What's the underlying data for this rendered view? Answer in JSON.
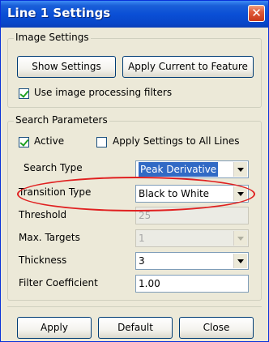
{
  "window": {
    "title": "Line 1 Settings",
    "close_glyph": "✕"
  },
  "image_settings": {
    "legend": "Image Settings",
    "show_settings_label": "Show Settings",
    "apply_current_label": "Apply Current to Feature",
    "use_filters_label": "Use image processing filters",
    "use_filters_checked": true
  },
  "search_params": {
    "legend": "Search Parameters",
    "active_label": "Active",
    "active_checked": true,
    "apply_all_label": "Apply Settings to All Lines",
    "apply_all_checked": false,
    "fields": {
      "search_type": {
        "label": "Search Type",
        "value": "Peak Derivative"
      },
      "transition_type": {
        "label": "Transition Type",
        "value": "Black to White"
      },
      "threshold": {
        "label": "Threshold",
        "value": "25"
      },
      "max_targets": {
        "label": "Max. Targets",
        "value": "1"
      },
      "thickness": {
        "label": "Thickness",
        "value": "3"
      },
      "filter_coefficient": {
        "label": "Filter Coefficient",
        "value": "1.00"
      }
    }
  },
  "footer": {
    "apply_label": "Apply",
    "default_label": "Default",
    "close_label": "Close"
  },
  "colors": {
    "titlebar": "#0a4fd6",
    "highlight": "#316ac5",
    "annotation": "#e02020"
  }
}
